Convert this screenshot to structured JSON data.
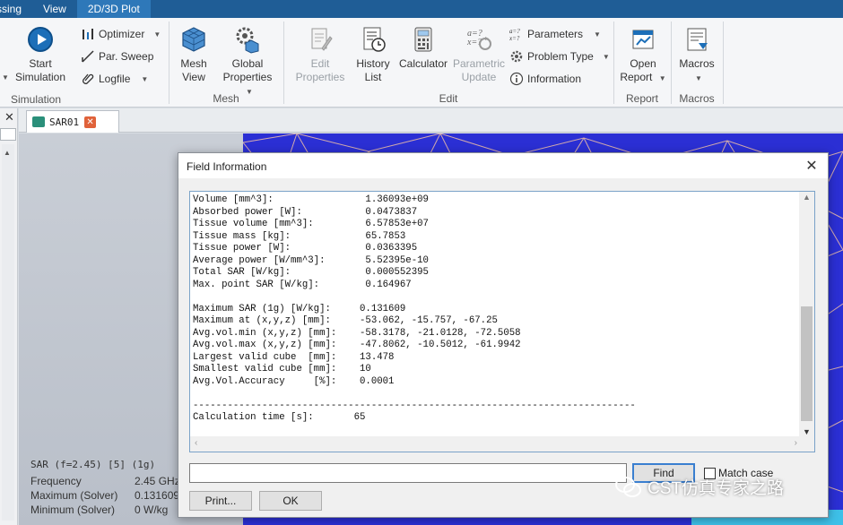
{
  "menubar": {
    "items": [
      "ssing",
      "View",
      "2D/3D Plot"
    ]
  },
  "ribbon": {
    "groups": {
      "simulation": "Simulation",
      "mesh": "Mesh",
      "edit": "Edit",
      "report": "Report",
      "macros": "Macros"
    },
    "start_simulation": "Start\nSimulation",
    "optimizer": "Optimizer",
    "par_sweep": "Par. Sweep",
    "logfile": "Logfile",
    "mesh_view": "Mesh\nView",
    "global_properties": "Global\nProperties",
    "edit_properties": "Edit\nProperties",
    "history_list": "History\nList",
    "calculator": "Calculator",
    "parametric_update": "Parametric\nUpdate",
    "parameters": "Parameters",
    "problem_type": "Problem Type",
    "information": "Information",
    "open_report": "Open\nReport",
    "macros_btn": "Macros"
  },
  "tab": {
    "label": "SAR01"
  },
  "sar_panel": {
    "header": "SAR (f=2.45) [5] (1g)",
    "rows": [
      {
        "label": "Frequency",
        "value": "2.45 GHz"
      },
      {
        "label": "Maximum (Solver)",
        "value": "0.131609"
      },
      {
        "label": "Minimum (Solver)",
        "value": "0 W/kg"
      }
    ]
  },
  "dialog": {
    "title": "Field Information",
    "lines": [
      "Volume [mm^3]:                1.36093e+09",
      "Absorbed power [W]:           0.0473837",
      "Tissue volume [mm^3]:         6.57853e+07",
      "Tissue mass [kg]:             65.7853",
      "Tissue power [W]:             0.0363395",
      "Average power [W/mm^3]:       5.52395e-10",
      "Total SAR [W/kg]:             0.000552395",
      "Max. point SAR [W/kg]:        0.164967",
      "",
      "Maximum SAR (1g) [W/kg]:     0.131609",
      "Maximum at (x,y,z) [mm]:     -53.062, -15.757, -67.25",
      "Avg.vol.min (x,y,z) [mm]:    -58.3178, -21.0128, -72.5058",
      "Avg.vol.max (x,y,z) [mm]:    -47.8062, -10.5012, -61.9942",
      "Largest valid cube  [mm]:    13.478",
      "Smallest valid cube [mm]:    10",
      "Avg.Vol.Accuracy     [%]:    0.0001",
      "",
      "-----------------------------------------------------------------------------",
      "Calculation time [s]:       65"
    ],
    "find_label": "Find",
    "match_case_label": "Match case",
    "print_label": "Print...",
    "ok_label": "OK",
    "find_value": ""
  },
  "watermark": "CST仿真专家之路",
  "colors": {
    "menubar": "#1f5d96",
    "mesh_blue": "#2a2fd6",
    "dialog_border": "#7aa2c8"
  }
}
